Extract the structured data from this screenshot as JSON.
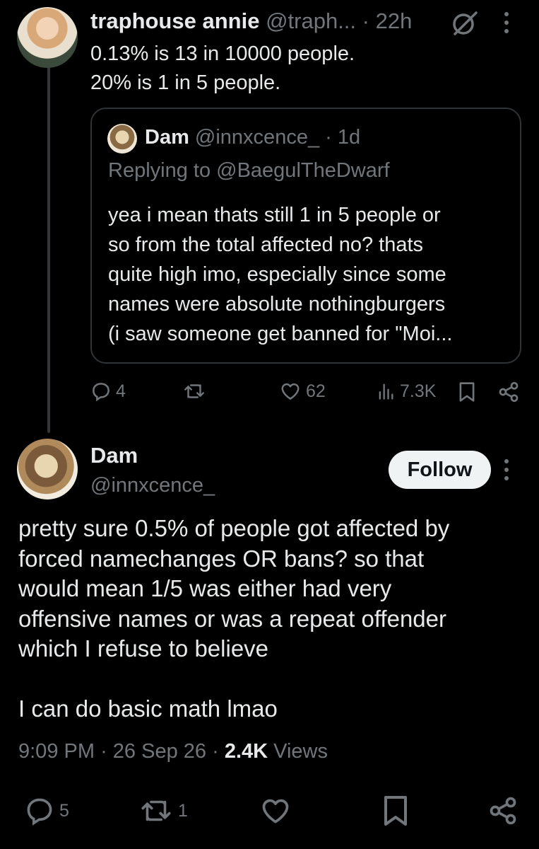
{
  "parent_tweet": {
    "display_name": "traphouse annie",
    "handle": "@traph...",
    "dot": "·",
    "time": "22h",
    "lines": [
      "0.13% is 13 in 10000 people.",
      "20% is 1 in 5 people."
    ],
    "quoted_tweet": {
      "display_name": "Dam",
      "handle": "@innxcence_",
      "dot": "·",
      "time": "1d",
      "replying_to": "Replying to @BaegulTheDwarf",
      "lines": [
        "yea i mean thats still 1 in 5 people or",
        "so from the total affected no? thats",
        "quite high imo, especially since some",
        "names were absolute nothingburgers",
        "(i saw someone get banned for \"Moi..."
      ]
    },
    "actions": {
      "replies": "4",
      "likes": "62",
      "views": "7.3K"
    }
  },
  "main_tweet": {
    "display_name": "Dam",
    "handle": "@innxcence_",
    "follow_label": "Follow",
    "paragraphs": [
      [
        "pretty sure 0.5% of people got affected by",
        "forced namechanges OR bans? so that",
        "would mean 1/5 was either had very",
        "offensive names or was a repeat offender",
        "which I refuse to believe"
      ],
      [
        "I can do basic math lmao"
      ]
    ],
    "time": "9:09 PM",
    "date": "26 Sep 26",
    "sep": "·",
    "views_count": "2.4K",
    "views_label": "Views",
    "actions": {
      "replies": "5",
      "reposts": "1"
    }
  },
  "colors": {
    "background": "#000000",
    "text": "#e7e9ea",
    "muted": "#71767b",
    "border": "#2f3336",
    "follow_bg": "#eff3f4"
  },
  "icons": [
    "grok-icon",
    "more-icon",
    "reply-icon",
    "repost-icon",
    "like-icon",
    "views-icon",
    "bookmark-icon",
    "share-icon"
  ]
}
